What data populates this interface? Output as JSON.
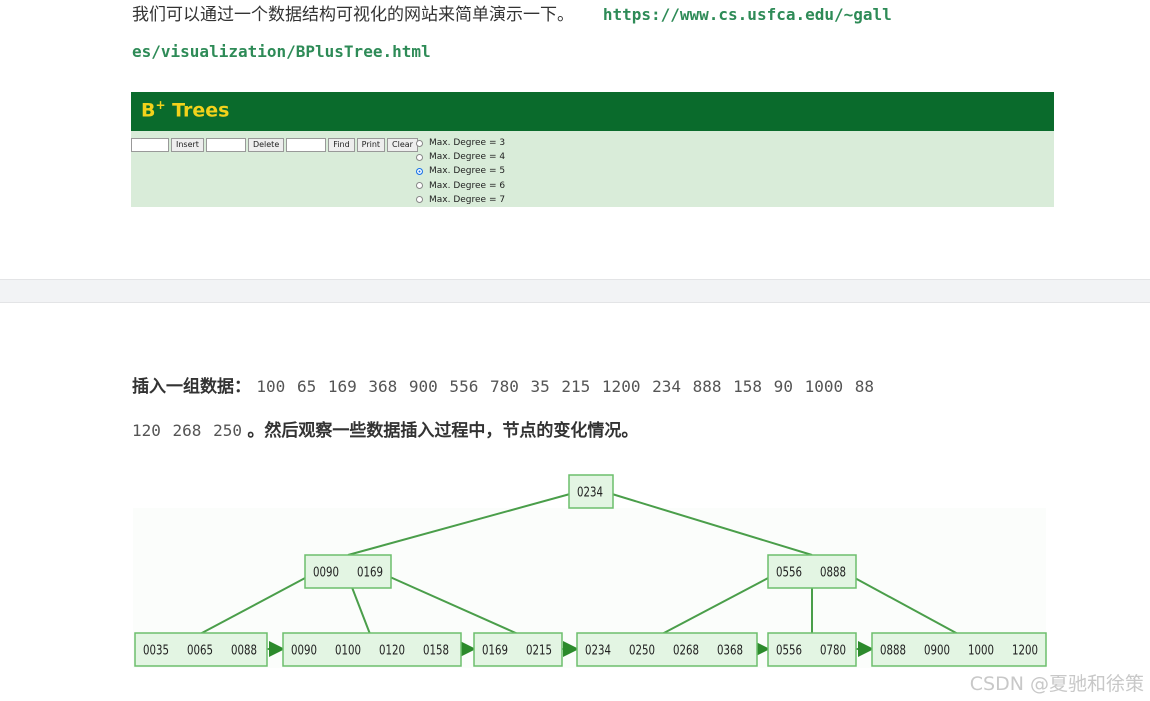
{
  "intro": {
    "text": "我们可以通过一个数据结构可视化的网站来简单演示一下。",
    "link_part1": "https://www.cs.usfca.edu/~gall",
    "link_part2": "es/visualization/BPlusTree.html"
  },
  "bplus_tool": {
    "title": "B",
    "title_sup": "+",
    "title_rest": " Trees",
    "buttons": [
      "Insert",
      "Delete",
      "Find",
      "Print",
      "Clear"
    ],
    "degree_options": [
      "Max. Degree = 3",
      "Max. Degree = 4",
      "Max. Degree = 5",
      "Max. Degree = 6",
      "Max. Degree = 7"
    ],
    "selected_degree_index": 2
  },
  "insert": {
    "prefix": "插入一组数据：",
    "data_line1": "100 65 169 368 900 556 780 35 215 1200 234 888 158 90 1000 88",
    "data_line2": "120 268 250",
    "suffix": "。然后观察一些数据插入过程中，节点的变化情况。"
  },
  "tree": {
    "root": [
      "0234"
    ],
    "internal": [
      [
        "0090",
        "0169"
      ],
      [
        "0556",
        "0888"
      ]
    ],
    "leaves": [
      [
        "0035",
        "0065",
        "0088"
      ],
      [
        "0090",
        "0100",
        "0120",
        "0158"
      ],
      [
        "0169",
        "0215"
      ],
      [
        "0234",
        "0250",
        "0268",
        "0368"
      ],
      [
        "0556",
        "0780"
      ],
      [
        "0888",
        "0900",
        "1000",
        "1200"
      ]
    ],
    "node_fill": "#e3f5e3",
    "node_stroke": "#6cbf6c",
    "edge_color": "#4a9e4a"
  },
  "watermark": "CSDN @夏驰和徐策"
}
